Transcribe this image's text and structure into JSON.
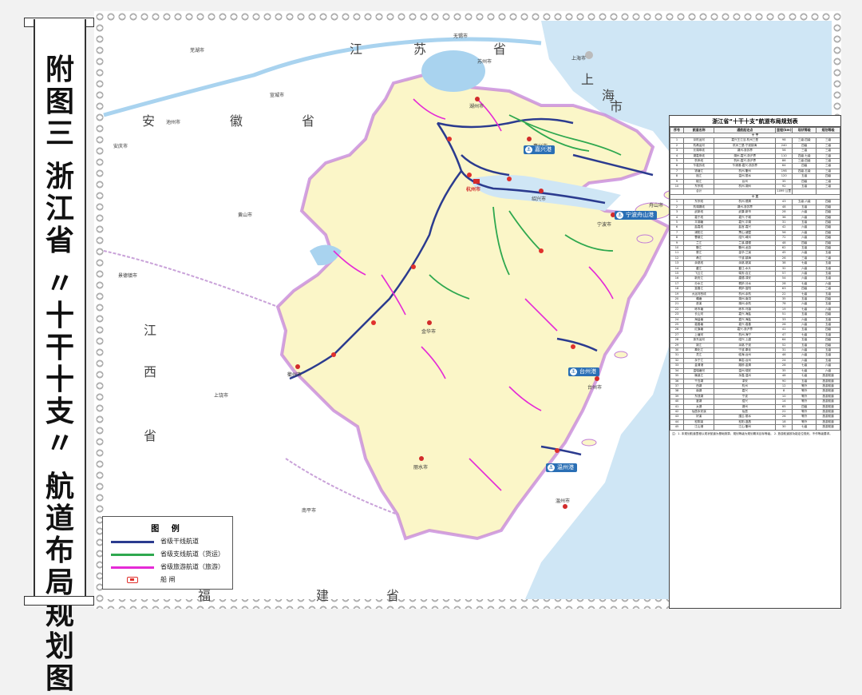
{
  "title_vertical": [
    "附",
    "图",
    "三",
    " ",
    "浙",
    "江",
    "省",
    " ",
    "〃",
    "十",
    "干",
    "十",
    "支",
    "〃",
    " ",
    "航",
    "道",
    "布",
    "局",
    "规",
    "划",
    "图"
  ],
  "colors": {
    "land_zhejiang": "#fbf6c8",
    "land_other": "#ffffff",
    "sea": "#cfe6f5",
    "lake": "#a9d3ef",
    "province_border": "#c07bd8",
    "main_channel": "#2b3b8f",
    "branch_freight": "#2fa84f",
    "tourism": "#e52ad6",
    "ship_lock": "#e0312d",
    "port_badge": "#2a6fb5"
  },
  "provinces": {
    "jiangsu": [
      "江",
      "苏",
      "省"
    ],
    "shanghai": [
      "上",
      "海",
      "市"
    ],
    "anhui": [
      "安",
      "徽",
      "省"
    ],
    "jiangxi": [
      "江",
      "西",
      "省"
    ],
    "fujian": [
      "福",
      "建",
      "省"
    ]
  },
  "cities": {
    "shanghai": "上海市",
    "hangzhou": "杭州市",
    "ningbo": "宁波市",
    "zhoushan": "舟山市",
    "jinhua": "金华市",
    "lishui": "丽水市",
    "wenzhou": "温州市",
    "taizhou": "台州市",
    "quzhou": "衢州市",
    "jiaxing": "嘉兴市",
    "huzhou": "湖州市",
    "shaoxing": "绍兴市",
    "wuhu": "芜湖市",
    "xuancheng": "宣城市",
    "huangshan": "黄山市",
    "jingdezhen": "景德镇市",
    "shangrao": "上饶市",
    "nanping": "南平市",
    "wuxi": "无锡市",
    "suzhou": "苏州市",
    "anqing": "安庆市",
    "chizhou": "池州市"
  },
  "ports": [
    {
      "name": "嘉兴港"
    },
    {
      "name": "宁波舟山港"
    },
    {
      "name": "台州港"
    },
    {
      "name": "温州港"
    }
  ],
  "legend": {
    "title": "图  例",
    "items": [
      {
        "label": "省级干线航道",
        "color": "#2b3b8f"
      },
      {
        "label": "省级支线航道（货运）",
        "color": "#2fa84f"
      },
      {
        "label": "省级旅游航道（旅游）",
        "color": "#e52ad6"
      },
      {
        "label": "船    闸",
        "color": "#e0312d"
      }
    ]
  },
  "table": {
    "title": "浙江省“十干十支”航道布局规划表",
    "headers": [
      "序号",
      "航道名称",
      "通航起讫点",
      "里程(km)",
      "现状等级",
      "规划等级"
    ],
    "trunk_section": "十 干",
    "trunk_rows": [
      [
        "1",
        "京杭运河",
        "嘉兴王江泾-杭州三堡",
        "98",
        "三级-四级",
        "三级"
      ],
      [
        "2",
        "杭甬运河",
        "杭州三堡-宁波镇海",
        "240",
        "四级",
        "三级"
      ],
      [
        "3",
        "长湖申线",
        "湖州-浙苏界",
        "56",
        "三级",
        "三级"
      ],
      [
        "4",
        "湖嘉申线",
        "湖州-嘉兴-浙沪界",
        "110",
        "四级-七级",
        "三级"
      ],
      [
        "5",
        "杭申线",
        "杭州-嘉兴-浙沪界",
        "86",
        "三级-四级",
        "三级"
      ],
      [
        "6",
        "乍嘉苏线",
        "乍浦港-嘉兴-浙苏界",
        "64",
        "四级",
        "三级"
      ],
      [
        "7",
        "钱塘江",
        "杭州-衢州",
        "198",
        "四级-五级",
        "三级"
      ],
      [
        "8",
        "瓯江",
        "温州-丽水",
        "120",
        "五级",
        "四级"
      ],
      [
        "9",
        "椒江",
        "台州",
        "35",
        "四级",
        "三级"
      ],
      [
        "10",
        "东宗线",
        "杭州-湖州",
        "92",
        "五级",
        "三级"
      ]
    ],
    "trunk_total": [
      "",
      "合计",
      "",
      "1099 公里",
      "",
      ""
    ],
    "branch_section": "十 支",
    "branch_rows": [
      [
        "1",
        "东宗线",
        "杭州-德清",
        "43",
        "五级-六级",
        "四级"
      ],
      [
        "2",
        "杭湖锡线",
        "湖州-浙苏界",
        "48",
        "五级",
        "四级"
      ],
      [
        "3",
        "武新线",
        "武康-新市",
        "28",
        "六级",
        "四级"
      ],
      [
        "4",
        "嘉于线",
        "嘉兴-于城",
        "36",
        "六级",
        "四级"
      ],
      [
        "5",
        "平湖塘",
        "嘉兴-平湖",
        "31",
        "五级",
        "四级"
      ],
      [
        "6",
        "盐嘉线",
        "盐官-嘉兴",
        "42",
        "六级",
        "四级"
      ],
      [
        "7",
        "浦阳江",
        "萧山-诸暨",
        "56",
        "六级",
        "四级"
      ],
      [
        "8",
        "曹娥江",
        "绍兴-嵊州",
        "72",
        "六级",
        "四级"
      ],
      [
        "9",
        "兰江",
        "兰溪-建德",
        "48",
        "四级",
        "四级"
      ],
      [
        "10",
        "衢江",
        "衢州-龙游",
        "62",
        "五级",
        "四级"
      ],
      [
        "11",
        "婺江",
        "金华-兰溪",
        "45",
        "六级",
        "五级"
      ],
      [
        "12",
        "甬江",
        "宁波-镇海",
        "26",
        "三级",
        "三级"
      ],
      [
        "13",
        "余慈线",
        "余姚-慈溪",
        "38",
        "七级",
        "五级"
      ],
      [
        "14",
        "鳌江",
        "鳌江-水头",
        "32",
        "六级",
        "五级"
      ],
      [
        "15",
        "飞云江",
        "瑞安-百丈",
        "57",
        "六级",
        "五级"
      ],
      [
        "16",
        "新安江",
        "建德-淳安",
        "54",
        "六级",
        "五级"
      ],
      [
        "17",
        "分水江",
        "桐庐-分水",
        "28",
        "七级",
        "六级"
      ],
      [
        "18",
        "富春江",
        "桐庐-富阳",
        "63",
        "四级",
        "三级"
      ],
      [
        "19",
        "大运河西线",
        "杭州-余杭",
        "22",
        "七级",
        "五级"
      ],
      [
        "20",
        "頔塘",
        "湖州-南浔",
        "35",
        "五级",
        "四级"
      ],
      [
        "21",
        "苕溪",
        "湖州-余杭",
        "78",
        "六级",
        "五级"
      ],
      [
        "22",
        "练市塘",
        "练市-乌镇",
        "19",
        "七级",
        "六级"
      ],
      [
        "23",
        "长山河",
        "嘉兴-海盐",
        "51",
        "五级",
        "四级"
      ],
      [
        "24",
        "海盐塘",
        "嘉兴-海盐",
        "33",
        "六级",
        "五级"
      ],
      [
        "25",
        "嘉善塘",
        "嘉兴-嘉善",
        "26",
        "六级",
        "五级"
      ],
      [
        "26",
        "红旗塘",
        "嘉兴-浙沪界",
        "41",
        "五级",
        "四级"
      ],
      [
        "27",
        "上塘河",
        "杭州-海宁",
        "47",
        "七级",
        "五级"
      ],
      [
        "28",
        "浙东运河",
        "绍兴-上虞",
        "64",
        "五级",
        "四级"
      ],
      [
        "29",
        "姚江",
        "余姚-宁波",
        "52",
        "五级",
        "四级"
      ],
      [
        "30",
        "奉化江",
        "宁波-奉化",
        "31",
        "六级",
        "五级"
      ],
      [
        "31",
        "灵江",
        "临海-台州",
        "46",
        "六级",
        "五级"
      ],
      [
        "32",
        "永宁江",
        "黄岩-台州",
        "24",
        "六级",
        "五级"
      ],
      [
        "33",
        "金清港",
        "路桥-金清",
        "28",
        "七级",
        "六级"
      ],
      [
        "34",
        "温瑞塘河",
        "温州-瑞安",
        "35",
        "七级",
        "六级"
      ],
      [
        "35",
        "楠溪江",
        "永嘉-温州",
        "48",
        "七级",
        "旅游航道"
      ],
      [
        "36",
        "千岛湖",
        "淳安",
        "90",
        "五级",
        "旅游航道"
      ],
      [
        "37",
        "西湖",
        "杭州",
        "12",
        "等外",
        "旅游航道"
      ],
      [
        "38",
        "南湖",
        "嘉兴",
        "8",
        "等外",
        "旅游航道"
      ],
      [
        "39",
        "东钱湖",
        "宁波",
        "10",
        "等外",
        "旅游航道"
      ],
      [
        "40",
        "鉴湖",
        "绍兴",
        "14",
        "等外",
        "旅游航道"
      ],
      [
        "41",
        "太湖",
        "湖州",
        "65",
        "四级",
        "旅游航道"
      ],
      [
        "42",
        "仙居永安溪",
        "仙居",
        "22",
        "等外",
        "旅游航道"
      ],
      [
        "43",
        "好溪",
        "缙云-丽水",
        "26",
        "等外",
        "旅游航道"
      ],
      [
        "44",
        "松阴溪",
        "松阳-遂昌",
        "18",
        "等外",
        "旅游航道"
      ],
      [
        "45",
        "江山港",
        "江山-衢州",
        "30",
        "七级",
        "旅游航道"
      ]
    ],
    "note": "注：1. 本规划航道里程以现状航道为基础测算，规划等级为规划期末目标等级。 2. 旅游航道按功能定位规划，不作等级要求。"
  }
}
